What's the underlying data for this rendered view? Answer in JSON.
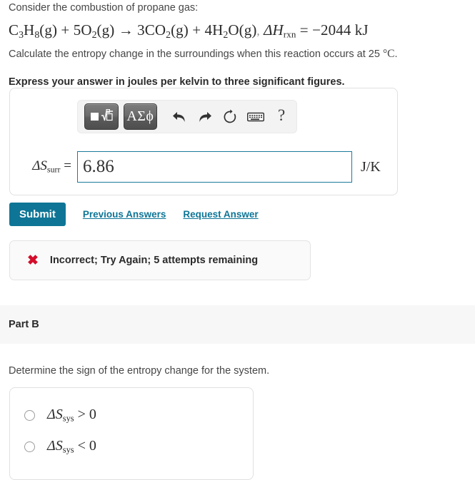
{
  "problem": {
    "intro": "Consider the combustion of propane gas:",
    "equation": {
      "reactant1": "C",
      "reactant1_sub1": "3",
      "reactant1_el2": "H",
      "reactant1_sub2": "8",
      "state1": "(g)",
      "plus1": "+",
      "coeff_o2": "5",
      "o2": "O",
      "o2_sub": "2",
      "state2": "(g)",
      "arrow": "→",
      "coeff_co2": "3",
      "co2": "CO",
      "co2_sub": "2",
      "state3": "(g)",
      "plus2": "+",
      "coeff_h2o": "4",
      "h2o": "H",
      "h2o_sub": "2",
      "h2o_o": "O",
      "state4": "(g)",
      "comma": ",",
      "delta_h": "ΔH",
      "delta_h_sub": "rxn",
      "equals": "=",
      "enthalpy_value": "−2044 kJ"
    },
    "equation_plain": "C3H8(g) + 5O2(g) → 3CO2(g) + 4H2O(g), ΔHrxn = −2044 kJ",
    "calculate_line_pre": "Calculate the entropy change in the surroundings when this reaction occurs at 25 ",
    "calculate_degree": "°C",
    "calculate_line_post": ".",
    "express_instruction": "Express your answer in joules per kelvin to three significant figures."
  },
  "toolbar": {
    "template_button": "template-icon",
    "greek_button": "ΑΣϕ",
    "undo": "undo-icon",
    "redo": "redo-icon",
    "reset": "reset-icon",
    "keyboard": "keyboard-icon",
    "help": "?"
  },
  "answer": {
    "label_delta": "ΔS",
    "label_sub": "surr",
    "label_equals": "=",
    "value": "6.86",
    "placeholder": "",
    "unit": "J/K"
  },
  "actions": {
    "submit_label": "Submit",
    "previous_answers_label": "Previous Answers",
    "request_answer_label": "Request Answer"
  },
  "feedback": {
    "icon": "✖",
    "icon_color": "#d40d2b",
    "message": "Incorrect; Try Again; 5 attempts remaining"
  },
  "part_b": {
    "title": "Part B",
    "question": "Determine the sign of the entropy change for the system.",
    "choices": [
      {
        "delta": "ΔS",
        "sub": "sys",
        "relation": "> 0",
        "selected": false
      },
      {
        "delta": "ΔS",
        "sub": "sys",
        "relation": "< 0",
        "selected": false
      }
    ]
  },
  "colors": {
    "accent": "#0e7596",
    "error": "#d40d2b",
    "band": "#f7f7f7",
    "input_border": "#1c7a99"
  }
}
